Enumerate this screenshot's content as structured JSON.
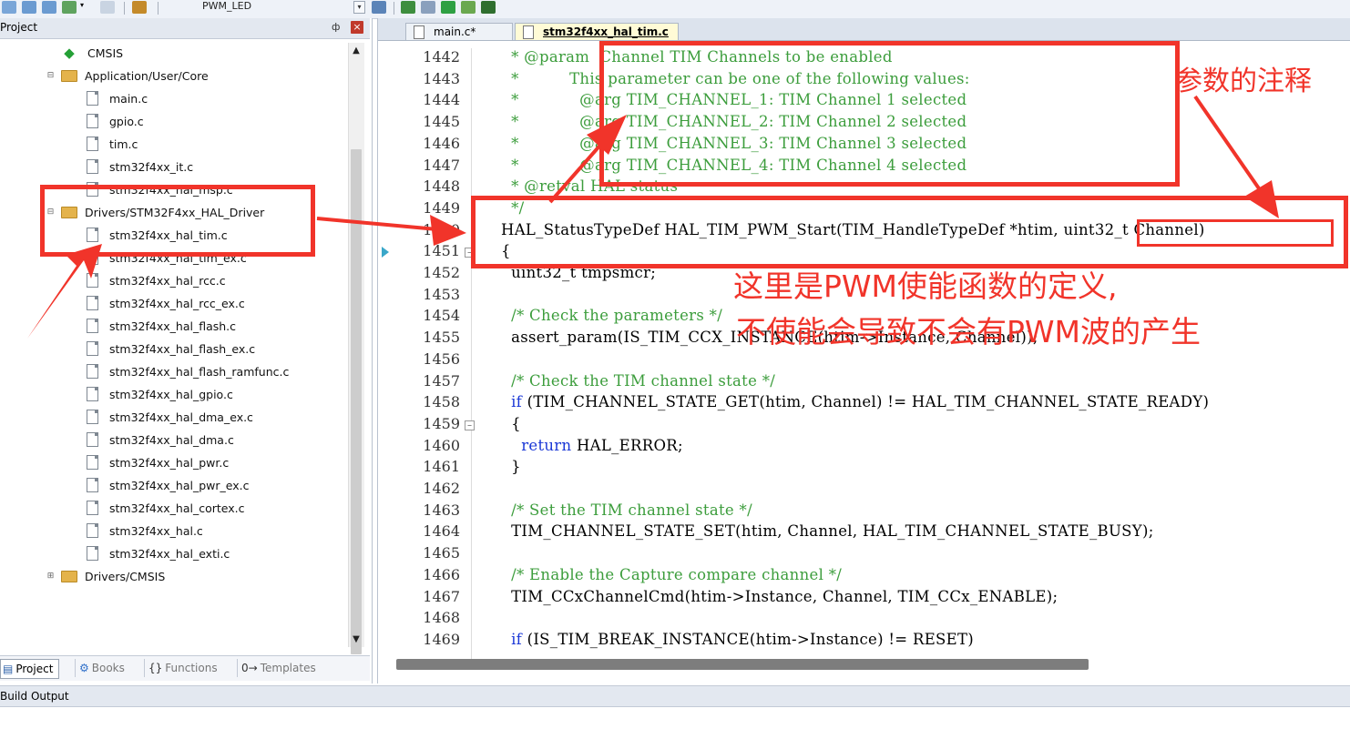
{
  "toolbar": {
    "target": "PWM_LED"
  },
  "project_panel": {
    "title": "Project",
    "pin": "❤",
    "close": "x",
    "tree": [
      {
        "label": "CMSIS",
        "type": "cmsis",
        "level": 2,
        "expander": ""
      },
      {
        "label": "Application/User/Core",
        "type": "folder",
        "level": 1,
        "expander": "⊟"
      },
      {
        "label": "main.c",
        "type": "file",
        "level": 3
      },
      {
        "label": "gpio.c",
        "type": "file",
        "level": 3
      },
      {
        "label": "tim.c",
        "type": "file",
        "level": 3
      },
      {
        "label": "stm32f4xx_it.c",
        "type": "file",
        "level": 3
      },
      {
        "label": "stm32f4xx_hal_msp.c",
        "type": "file",
        "level": 3
      },
      {
        "label": "Drivers/STM32F4xx_HAL_Driver",
        "type": "folder",
        "level": 1,
        "expander": "⊟"
      },
      {
        "label": "stm32f4xx_hal_tim.c",
        "type": "file",
        "level": 3
      },
      {
        "label": "stm32f4xx_hal_tim_ex.c",
        "type": "file",
        "level": 3
      },
      {
        "label": "stm32f4xx_hal_rcc.c",
        "type": "file",
        "level": 3
      },
      {
        "label": "stm32f4xx_hal_rcc_ex.c",
        "type": "file",
        "level": 3
      },
      {
        "label": "stm32f4xx_hal_flash.c",
        "type": "file",
        "level": 3
      },
      {
        "label": "stm32f4xx_hal_flash_ex.c",
        "type": "file",
        "level": 3
      },
      {
        "label": "stm32f4xx_hal_flash_ramfunc.c",
        "type": "file",
        "level": 3
      },
      {
        "label": "stm32f4xx_hal_gpio.c",
        "type": "file",
        "level": 3
      },
      {
        "label": "stm32f4xx_hal_dma_ex.c",
        "type": "file",
        "level": 3
      },
      {
        "label": "stm32f4xx_hal_dma.c",
        "type": "file",
        "level": 3
      },
      {
        "label": "stm32f4xx_hal_pwr.c",
        "type": "file",
        "level": 3
      },
      {
        "label": "stm32f4xx_hal_pwr_ex.c",
        "type": "file",
        "level": 3
      },
      {
        "label": "stm32f4xx_hal_cortex.c",
        "type": "file",
        "level": 3
      },
      {
        "label": "stm32f4xx_hal.c",
        "type": "file",
        "level": 3
      },
      {
        "label": "stm32f4xx_hal_exti.c",
        "type": "file",
        "level": 3
      },
      {
        "label": "Drivers/CMSIS",
        "type": "folder",
        "level": 1,
        "expander": "⊞"
      }
    ],
    "tabs": [
      {
        "label": "Project",
        "icon": "▤"
      },
      {
        "label": "Books",
        "icon": "⚙"
      },
      {
        "label": "Functions",
        "icon": "{}"
      },
      {
        "label": "Templates",
        "icon": "0→"
      }
    ]
  },
  "editor": {
    "tabs": [
      "main.c*",
      "stm32f4xx_hal_tim.c"
    ],
    "lines": [
      {
        "n": "1442",
        "t": "  * @param  Channel TIM Channels to be enabled",
        "k": "cm"
      },
      {
        "n": "1443",
        "t": "  *          This parameter can be one of the following values:",
        "k": "cm"
      },
      {
        "n": "1444",
        "t": "  *            @arg TIM_CHANNEL_1: TIM Channel 1 selected",
        "k": "cm"
      },
      {
        "n": "1445",
        "t": "  *            @arg TIM_CHANNEL_2: TIM Channel 2 selected",
        "k": "cm"
      },
      {
        "n": "1446",
        "t": "  *            @arg TIM_CHANNEL_3: TIM Channel 3 selected",
        "k": "cm"
      },
      {
        "n": "1447",
        "t": "  *            @arg TIM_CHANNEL_4: TIM Channel 4 selected",
        "k": "cm"
      },
      {
        "n": "1448",
        "t": "  * @retval HAL status",
        "k": "cm"
      },
      {
        "n": "1449",
        "t": "  */",
        "k": "cm"
      },
      {
        "n": "1450",
        "t": "HAL_StatusTypeDef HAL_TIM_PWM_Start(TIM_HandleTypeDef *htim, uint32_t Channel)",
        "k": ""
      },
      {
        "n": "1451",
        "t": "{",
        "k": ""
      },
      {
        "n": "1452",
        "t": "  uint32_t tmpsmcr;",
        "k": ""
      },
      {
        "n": "1453",
        "t": "",
        "k": ""
      },
      {
        "n": "1454",
        "t": "  /* Check the parameters */",
        "k": "cm"
      },
      {
        "n": "1455",
        "t": "  assert_param(IS_TIM_CCX_INSTANCE(htim->Instance, Channel));",
        "k": ""
      },
      {
        "n": "1456",
        "t": "",
        "k": ""
      },
      {
        "n": "1457",
        "t": "  /* Check the TIM channel state */",
        "k": "cm"
      },
      {
        "n": "1458",
        "t": "  if (TIM_CHANNEL_STATE_GET(htim, Channel) != HAL_TIM_CHANNEL_STATE_READY)",
        "k": "if"
      },
      {
        "n": "1459",
        "t": "  {",
        "k": ""
      },
      {
        "n": "1460",
        "t": "    return HAL_ERROR;",
        "k": "ret"
      },
      {
        "n": "1461",
        "t": "  }",
        "k": ""
      },
      {
        "n": "1462",
        "t": "",
        "k": ""
      },
      {
        "n": "1463",
        "t": "  /* Set the TIM channel state */",
        "k": "cm"
      },
      {
        "n": "1464",
        "t": "  TIM_CHANNEL_STATE_SET(htim, Channel, HAL_TIM_CHANNEL_STATE_BUSY);",
        "k": ""
      },
      {
        "n": "1465",
        "t": "",
        "k": ""
      },
      {
        "n": "1466",
        "t": "  /* Enable the Capture compare channel */",
        "k": "cm"
      },
      {
        "n": "1467",
        "t": "  TIM_CCxChannelCmd(htim->Instance, Channel, TIM_CCx_ENABLE);",
        "k": ""
      },
      {
        "n": "1468",
        "t": "",
        "k": ""
      },
      {
        "n": "1469",
        "t": "  if (IS_TIM_BREAK_INSTANCE(htim->Instance) != RESET)",
        "k": "if"
      }
    ]
  },
  "build_output": {
    "title": "Build Output"
  },
  "annotations": {
    "param_comment": "参数的注释",
    "pwm_line1": "这里是PWM使能函数的定义,",
    "pwm_line2": "不使能会导致不会有PWM波的产生",
    "color": "#f1342a"
  }
}
